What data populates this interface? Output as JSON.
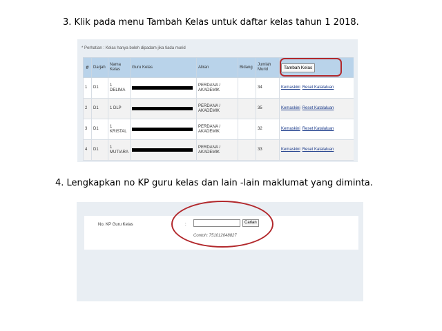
{
  "step3": {
    "heading": "3. Klik pada menu Tambah Kelas untuk daftar kelas tahun 1 2018."
  },
  "step4": {
    "heading": "4. Lengkapkan no KP guru kelas dan lain -lain maklumat yang diminta."
  },
  "panel1": {
    "notice": "* Perhatian : Kelas hanya boleh dipadam jika tiada murid",
    "table": {
      "headers": {
        "num": "#",
        "darjah": "Darjah",
        "nama_kelas": "Nama Kelas",
        "guru_kelas": "Guru Kelas",
        "aliran": "Aliran",
        "bidang": "Bidang",
        "jumlah_murid": "Jumlah Murid"
      },
      "add_button": "Tambah Kelas",
      "rows": [
        {
          "num": "1",
          "darjah": "D1",
          "nama_kelas": "1 DELIMA",
          "aliran": "PERDANA / AKADEMIK",
          "bidang": "",
          "jumlah": "34",
          "edit": "Kemaskini",
          "reset": "Reset Katalaluan"
        },
        {
          "num": "2",
          "darjah": "D1",
          "nama_kelas": "1 DLP",
          "aliran": "PERDANA / AKADEMIK",
          "bidang": "",
          "jumlah": "35",
          "edit": "Kemaskini",
          "reset": "Reset Katalaluan"
        },
        {
          "num": "3",
          "darjah": "D1",
          "nama_kelas": "1 KRISTAL",
          "aliran": "PERDANA / AKADEMIK",
          "bidang": "",
          "jumlah": "32",
          "edit": "Kemaskini",
          "reset": "Reset Katalaluan"
        },
        {
          "num": "4",
          "darjah": "D1",
          "nama_kelas": "1 MUTIARA",
          "aliran": "PERDANA / AKADEMIK",
          "bidang": "",
          "jumlah": "33",
          "edit": "Kemaskini",
          "reset": "Reset Katalaluan"
        }
      ]
    }
  },
  "panel2": {
    "label": "No. KP Guru Kelas",
    "colon": ":",
    "input_value": "",
    "search_button": "Carian",
    "example": "Contoh: 751012048827"
  },
  "colors": {
    "highlight": "#b2282c",
    "table_header": "#b9d3ea",
    "panel_bg": "#e9eef3",
    "link": "#1a3a8a"
  }
}
